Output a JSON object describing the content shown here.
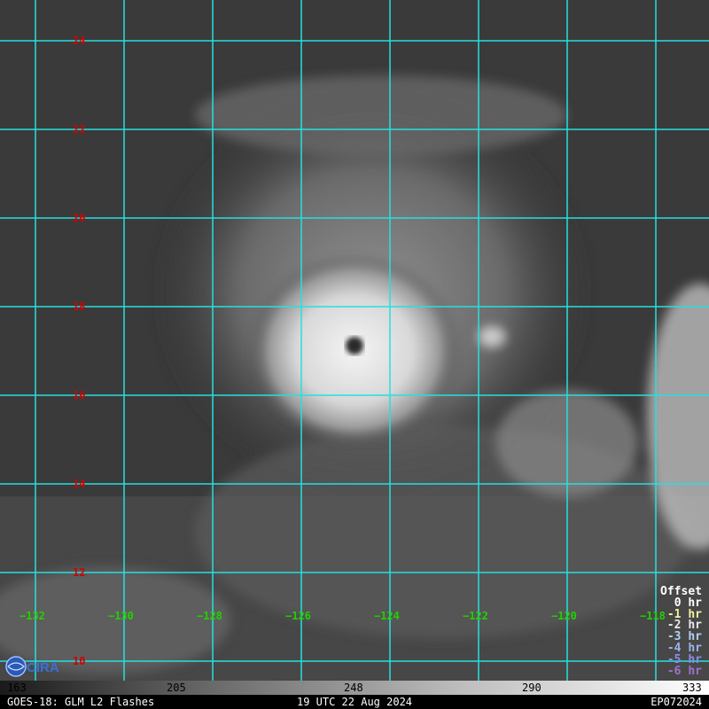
{
  "image": {
    "subject": "satellite-ir-tropical-cyclone",
    "colors": {
      "grid": "#25e0e0",
      "lat_label": "#d40000",
      "lon_label": "#22d000"
    }
  },
  "grid": {
    "latitudes": [
      "24",
      "22",
      "20",
      "18",
      "16",
      "14",
      "12",
      "10"
    ],
    "longitudes": [
      "−132",
      "−130",
      "−128",
      "−126",
      "−124",
      "−122",
      "−120",
      "−118"
    ]
  },
  "legend": {
    "title": "Offset",
    "items": [
      {
        "label": "0 hr",
        "color": "#ffffff"
      },
      {
        "label": "-1 hr",
        "color": "#f2f2a0"
      },
      {
        "label": "-2 hr",
        "color": "#e8e8e8"
      },
      {
        "label": "-3 hr",
        "color": "#b4d0f0"
      },
      {
        "label": "-4 hr",
        "color": "#9cb4ec"
      },
      {
        "label": "-5 hr",
        "color": "#8c8cf0"
      },
      {
        "label": "-6 hr",
        "color": "#a070d0"
      }
    ]
  },
  "colorbar": {
    "ticks": [
      "163",
      "205",
      "248",
      "290",
      "333"
    ]
  },
  "footer": {
    "left": "GOES-18: GLM L2 Flashes",
    "center": "19 UTC 22 Aug 2024",
    "right": "EP072024"
  },
  "logo": {
    "name": "cira-logo-icon",
    "text": "CIRA"
  }
}
